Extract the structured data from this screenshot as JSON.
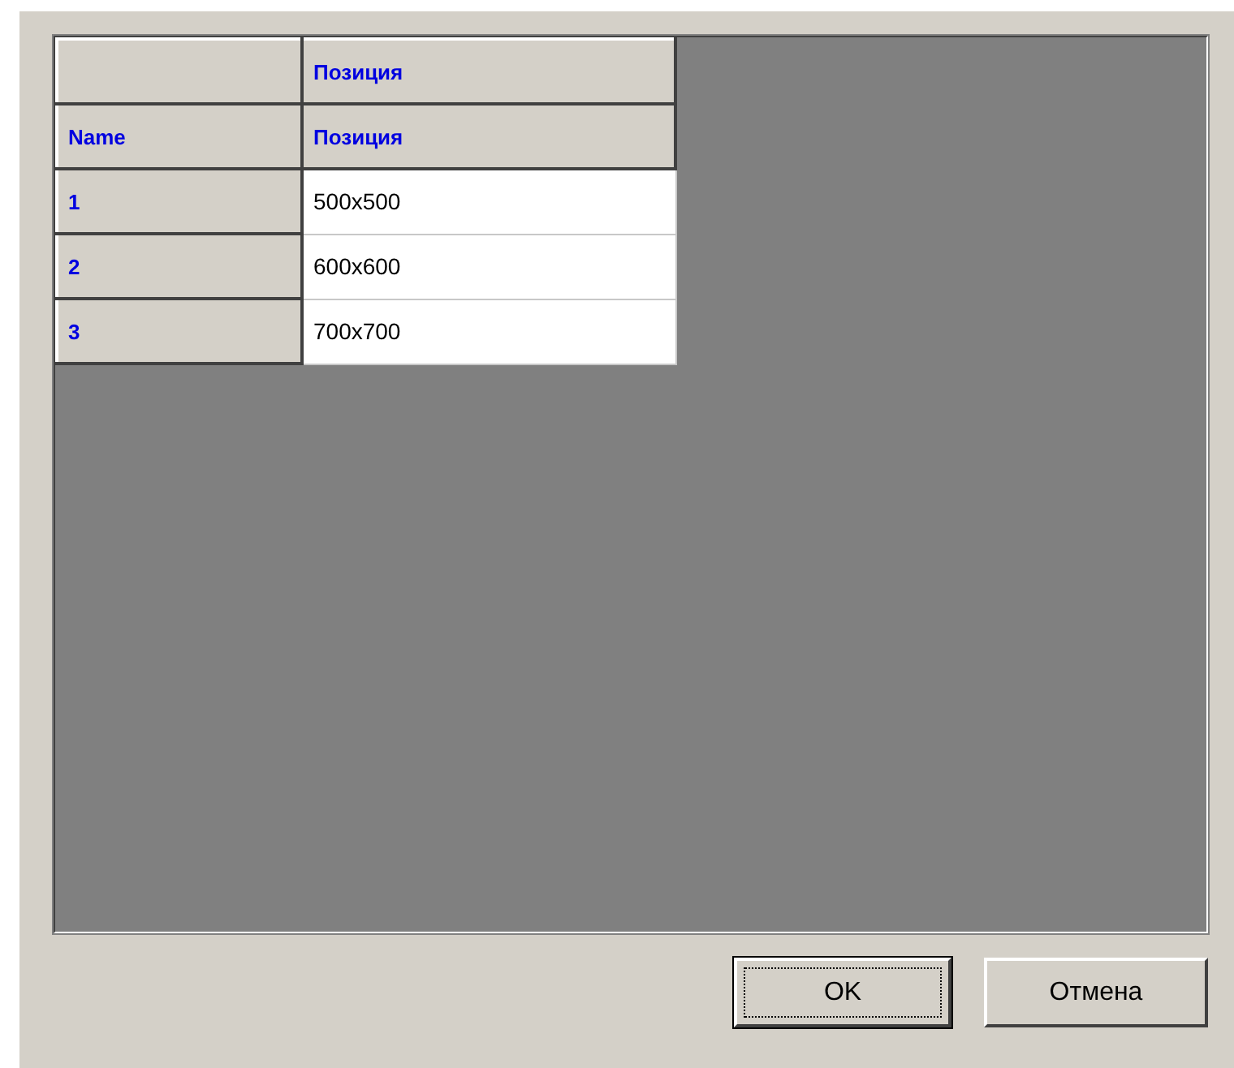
{
  "grid": {
    "group_header": {
      "label": "Позиция"
    },
    "columns": [
      "Name",
      "Позиция"
    ],
    "rows": [
      {
        "name": "1",
        "value": "500x500"
      },
      {
        "name": "2",
        "value": "600x600"
      },
      {
        "name": "3",
        "value": "700x700"
      }
    ]
  },
  "buttons": [
    {
      "label": "OK",
      "focused": true
    },
    {
      "label": "Отмена",
      "focused": false
    }
  ]
}
